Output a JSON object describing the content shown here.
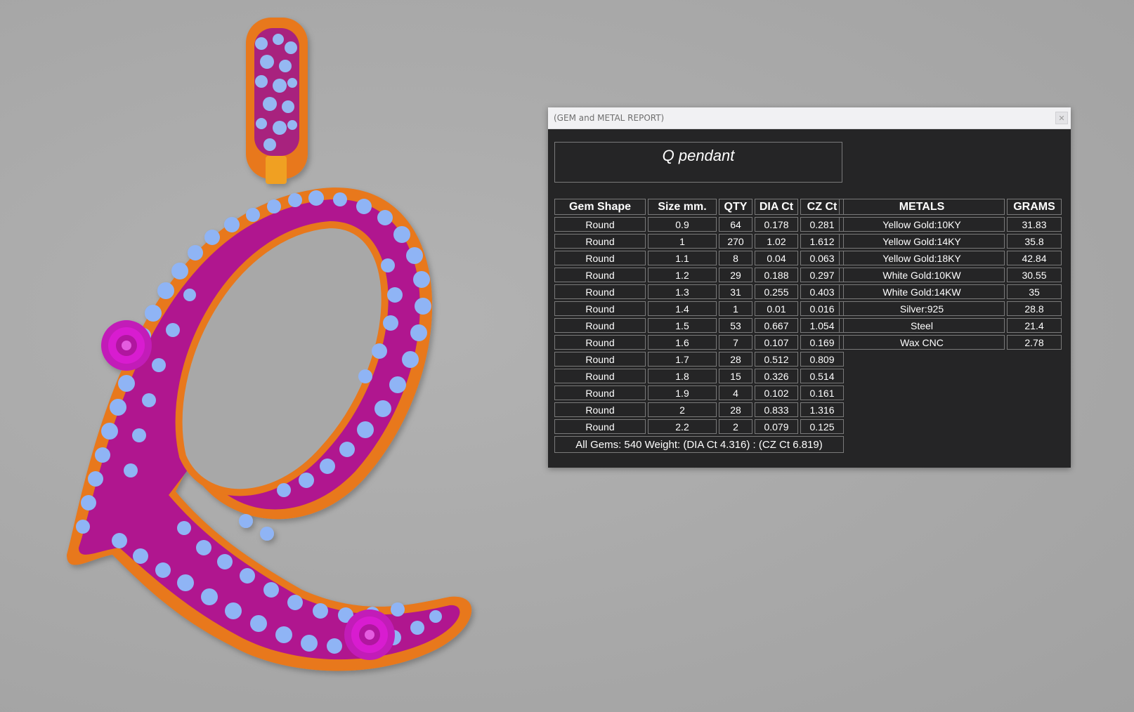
{
  "window": {
    "title": "(GEM and METAL REPORT)",
    "close_icon": "close-icon"
  },
  "report_name": "Q pendant",
  "gem_table": {
    "headers": [
      "Gem Shape",
      "Size mm.",
      "QTY",
      "DIA Ct",
      "CZ Ct"
    ],
    "rows": [
      [
        "Round",
        "0.9",
        "64",
        "0.178",
        "0.281"
      ],
      [
        "Round",
        "1",
        "270",
        "1.02",
        "1.612"
      ],
      [
        "Round",
        "1.1",
        "8",
        "0.04",
        "0.063"
      ],
      [
        "Round",
        "1.2",
        "29",
        "0.188",
        "0.297"
      ],
      [
        "Round",
        "1.3",
        "31",
        "0.255",
        "0.403"
      ],
      [
        "Round",
        "1.4",
        "1",
        "0.01",
        "0.016"
      ],
      [
        "Round",
        "1.5",
        "53",
        "0.667",
        "1.054"
      ],
      [
        "Round",
        "1.6",
        "7",
        "0.107",
        "0.169"
      ],
      [
        "Round",
        "1.7",
        "28",
        "0.512",
        "0.809"
      ],
      [
        "Round",
        "1.8",
        "15",
        "0.326",
        "0.514"
      ],
      [
        "Round",
        "1.9",
        "4",
        "0.102",
        "0.161"
      ],
      [
        "Round",
        "2",
        "28",
        "0.833",
        "1.316"
      ],
      [
        "Round",
        "2.2",
        "2",
        "0.079",
        "0.125"
      ]
    ],
    "summary": "All Gems: 540  Weight: (DIA Ct 4.316) : (CZ Ct 6.819)"
  },
  "metal_table": {
    "headers": [
      "METALS",
      "GRAMS"
    ],
    "rows": [
      [
        "Yellow Gold:10KY",
        "31.83"
      ],
      [
        "Yellow Gold:14KY",
        "35.8"
      ],
      [
        "Yellow Gold:18KY",
        "42.84"
      ],
      [
        "White Gold:10KW",
        "30.55"
      ],
      [
        "White Gold:14KW",
        "35"
      ],
      [
        "Silver:925",
        "28.8"
      ],
      [
        "Steel",
        "21.4"
      ],
      [
        "Wax  CNC",
        "2.78"
      ]
    ]
  },
  "colors": {
    "metal": "#e8781a",
    "setting": "#b0158f",
    "stone": "#8fb4f5",
    "rose": "#d81fd0",
    "panel": "#252526",
    "background": "#aaaaaa"
  }
}
